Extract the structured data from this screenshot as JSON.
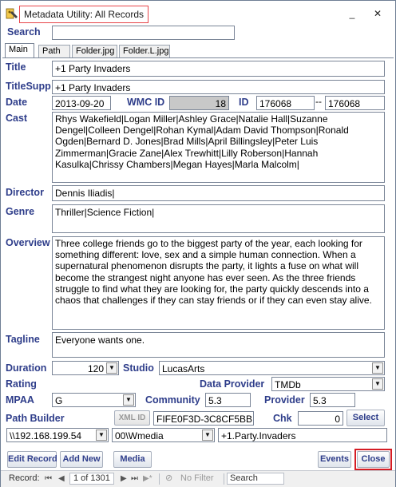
{
  "window": {
    "title": "Metadata Utility: All Records",
    "minimize": "_",
    "close": "✕"
  },
  "search": {
    "label": "Search",
    "value": ""
  },
  "tabs": [
    {
      "label": "Main"
    },
    {
      "label": "Path"
    },
    {
      "label": "Folder.jpg"
    },
    {
      "label": "Folder.L.jpg"
    }
  ],
  "fields": {
    "title": {
      "label": "Title",
      "value": "+1 Party Invaders"
    },
    "title_supp": {
      "label": "TitleSupp",
      "value": "+1 Party Invaders"
    },
    "date": {
      "label": "Date",
      "value": "2013-09-20"
    },
    "wmc_id": {
      "label": "WMC ID",
      "value": "18"
    },
    "id": {
      "label": "ID",
      "value": "176068",
      "dash": "--",
      "value2": "176068"
    },
    "cast": {
      "label": "Cast",
      "value": "Rhys Wakefield|Logan Miller|Ashley Grace|Natalie Hall|Suzanne Dengel|Colleen Dengel|Rohan Kymal|Adam David Thompson|Ronald Ogden|Bernard D. Jones|Brad Mills|April Billingsley|Peter Luis Zimmerman|Gracie Zane|Alex Trewhitt|Lilly Roberson|Hannah Kasulka|Chrissy Chambers|Megan Hayes|Marla Malcolm|"
    },
    "director": {
      "label": "Director",
      "value": "Dennis Iliadis|"
    },
    "genre": {
      "label": "Genre",
      "value": "Thriller|Science Fiction|"
    },
    "overview": {
      "label": "Overview",
      "value": "Three college friends go to the biggest party of the year, each looking for something different: love, sex and a simple human connection. When a supernatural phenomenon disrupts the party, it lights a fuse on what will become the strangest night anyone has ever seen. As the three friends struggle to find what they are looking for, the party quickly descends into a chaos that challenges if they can stay friends or if they can even stay alive."
    },
    "tagline": {
      "label": "Tagline",
      "value": "Everyone wants one."
    },
    "duration": {
      "label": "Duration",
      "value": "120"
    },
    "studio": {
      "label": "Studio",
      "value": "LucasArts"
    },
    "rating": {
      "label": "Rating"
    },
    "data_provider": {
      "label": "Data Provider",
      "value": "TMDb"
    },
    "mpaa": {
      "label": "MPAA",
      "value": "G"
    },
    "community": {
      "label": "Community",
      "value": "5.3"
    },
    "provider": {
      "label": "Provider",
      "value": "5.3"
    },
    "path_builder": {
      "label": "Path Builder",
      "xml_button": "XML ID",
      "hash": "FIFE0F3D-3C8CF5BB"
    },
    "chk": {
      "label": "Chk",
      "value": "0",
      "select_button": "Select"
    },
    "path": {
      "server": "\\\\192.168.199.54",
      "share": "00\\Wmedia",
      "folder": "+1.Party.Invaders"
    }
  },
  "buttons": {
    "edit_record": "Edit Record",
    "add_new": "Add New",
    "media": "Media",
    "events": "Events",
    "close": "Close"
  },
  "statusbar": {
    "record_label": "Record:",
    "position": "1 of 1301",
    "filter": "No Filter",
    "search": "Search"
  },
  "colors": {
    "label": "#2e3d8a",
    "accent_outline": "#d51c24",
    "title_outline": "#e8454a"
  }
}
